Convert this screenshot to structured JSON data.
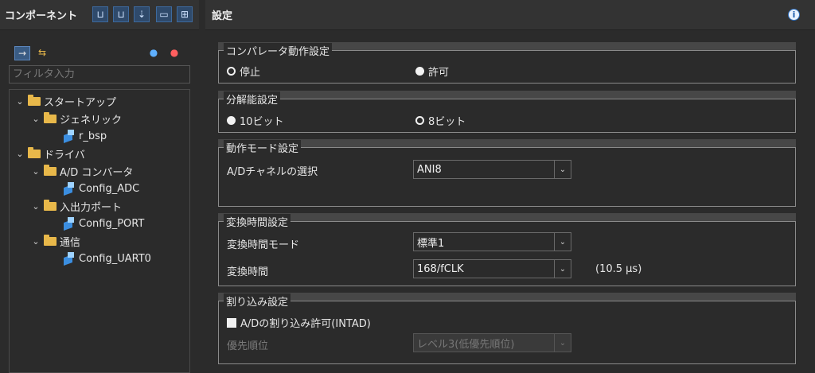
{
  "left_panel": {
    "title": "コンポーネント",
    "filter_placeholder": "フィルタ入力",
    "tree": [
      {
        "label": "スタートアップ",
        "type": "folder"
      },
      {
        "label": "ジェネリック",
        "type": "folder"
      },
      {
        "label": "r_bsp",
        "type": "component"
      },
      {
        "label": "ドライバ",
        "type": "folder"
      },
      {
        "label": "A/D コンバータ",
        "type": "folder"
      },
      {
        "label": "Config_ADC",
        "type": "component"
      },
      {
        "label": "入出力ポート",
        "type": "folder"
      },
      {
        "label": "Config_PORT",
        "type": "component"
      },
      {
        "label": "通信",
        "type": "folder"
      },
      {
        "label": "Config_UART0",
        "type": "component"
      }
    ]
  },
  "right_panel": {
    "title": "設定",
    "comparator": {
      "legend": "コンパレータ動作設定",
      "options": [
        "停止",
        "許可"
      ],
      "selected": "許可"
    },
    "resolution": {
      "legend": "分解能設定",
      "options": [
        "10ビット",
        "8ビット"
      ],
      "selected": "10ビット"
    },
    "operation_mode": {
      "legend": "動作モード設定",
      "channel_label": "A/Dチャネルの選択",
      "channel_value": "ANI8"
    },
    "conversion": {
      "legend": "変換時間設定",
      "mode_label": "変換時間モード",
      "mode_value": "標準1",
      "time_label": "変換時間",
      "time_value": "168/fCLK",
      "time_note": "(10.5 μs)"
    },
    "interrupt": {
      "legend": "割り込み設定",
      "enable_label": "A/Dの割り込み許可(INTAD)",
      "enable_checked": false,
      "priority_label": "優先順位",
      "priority_value": "レベル3(低優先順位)"
    }
  }
}
